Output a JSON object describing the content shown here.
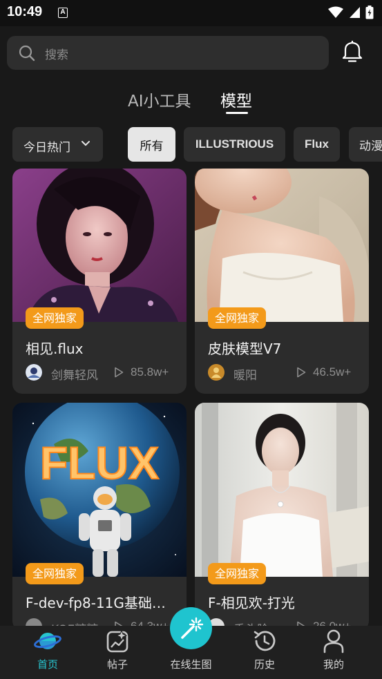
{
  "status_bar": {
    "time": "10:49",
    "notification_glyph": "A"
  },
  "search": {
    "placeholder": "搜索"
  },
  "top_tabs": [
    {
      "label": "AI小工具"
    },
    {
      "label": "模型"
    }
  ],
  "sort": {
    "label": "今日热门"
  },
  "chips": [
    {
      "label": "所有"
    },
    {
      "label": "ILLUSTRIOUS"
    },
    {
      "label": "Flux"
    },
    {
      "label": "动漫"
    }
  ],
  "cards": [
    {
      "badge": "全网独家",
      "title": "相见.flux",
      "author": "剑舞轻风",
      "views": "85.8w+"
    },
    {
      "badge": "全网独家",
      "title": "皮肤模型V7",
      "author": "暖阳",
      "views": "46.5w+"
    },
    {
      "badge": "全网独家",
      "title": "F-dev-fp8-11G基础…",
      "author": "KOE糖糖",
      "views": "64.3w+",
      "image_text": "FLUX"
    },
    {
      "badge": "全网独家",
      "title": "F-相见欢-打光",
      "author": "香头脸",
      "views": "26.0w+"
    }
  ],
  "bottom_nav": {
    "items": [
      {
        "label": "首页",
        "icon": "planet-home-icon"
      },
      {
        "label": "帖子",
        "icon": "post-icon"
      },
      {
        "label": "在线生图",
        "icon": "magic-wand-icon"
      },
      {
        "label": "历史",
        "icon": "history-icon"
      },
      {
        "label": "我的",
        "icon": "person-icon"
      }
    ]
  },
  "colors": {
    "accent": "#27c5cf",
    "badge": "#f39a1a",
    "background": "#191919"
  }
}
